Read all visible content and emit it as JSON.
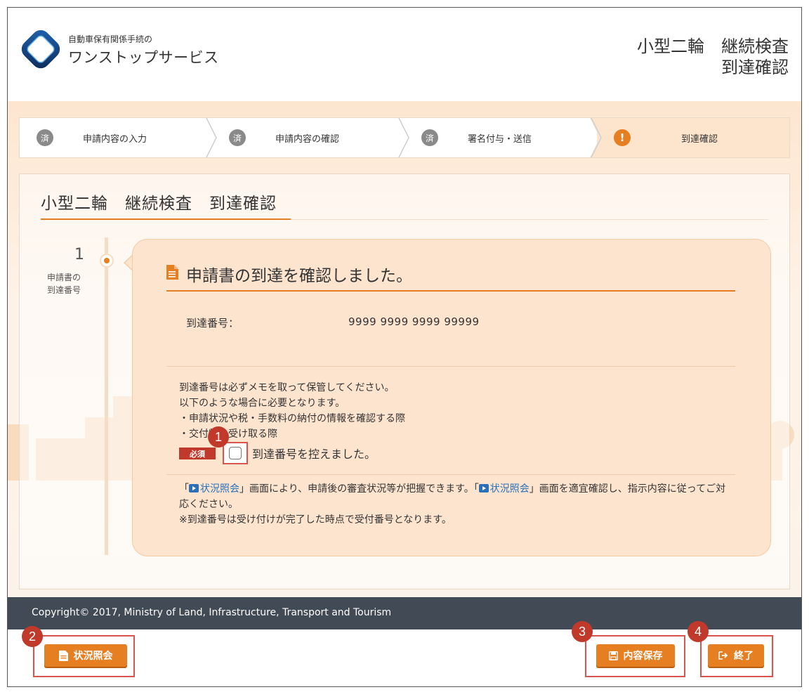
{
  "header": {
    "logo_sub": "自動車保有関係手続の",
    "logo_main": "ワンストップサービス",
    "title_line1_a": "小型二輪",
    "title_line1_b": "継続検査",
    "title_line2": "到達確認"
  },
  "steps": [
    {
      "badge": "済",
      "label": "申請内容の入力"
    },
    {
      "badge": "済",
      "label": "申請内容の確認"
    },
    {
      "badge": "済",
      "label": "署名付与・送信"
    },
    {
      "badge": "!",
      "label": "到達確認"
    }
  ],
  "panel": {
    "title_a": "小型二輪",
    "title_b": "継続検査",
    "title_c": "到達確認",
    "step_number": "1",
    "step_caption_1": "申請書の",
    "step_caption_2": "到達番号"
  },
  "bubble": {
    "heading": "申請書の到達を確認しました。",
    "field_label": "到達番号：",
    "field_value": "9999 9999 9999 99999",
    "notes": [
      "到達番号は必ずメモを取って保管してください。",
      "以下のような場合に必要となります。",
      "・申請状況や税・手数料の納付の情報を確認する際",
      "・交付物を受け取る際"
    ],
    "required_tag": "必須",
    "checkbox_label": "到達番号を控えました。",
    "info_part1": "「",
    "info_link": "状況照会",
    "info_part2": "」画面により、申請後の審査状況等が把握できます。「",
    "info_part3": "」画面を適宜確認し、指示内容に従ってご対応ください。",
    "info_line3": "※到達番号は受け付けが完了した時点で受付番号となります。"
  },
  "footer": {
    "copyright": "Copyright© 2017, Ministry of Land, Infrastructure, Transport and Tourism"
  },
  "buttons": {
    "status": "状況照会",
    "save": "内容保存",
    "end": "終了"
  },
  "callouts": [
    "1",
    "2",
    "3",
    "4"
  ],
  "colors": {
    "accent": "#e67e22",
    "highlight": "#d9534f",
    "footer": "#424a55"
  }
}
